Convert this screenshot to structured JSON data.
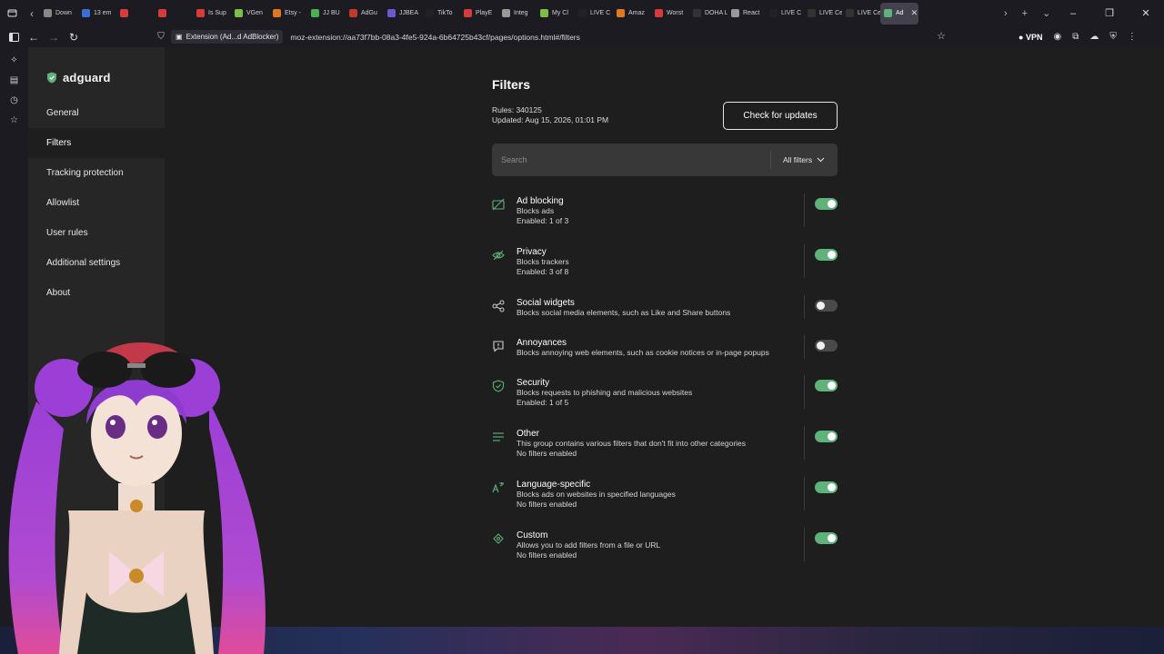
{
  "browser": {
    "tabs": [
      {
        "label": "Down",
        "color": "#888888"
      },
      {
        "label": "13 em",
        "color": "#3b6fd6"
      },
      {
        "label": "",
        "color": "#d93a3a"
      },
      {
        "label": "",
        "color": "#d93a3a"
      },
      {
        "label": "Is Sup",
        "color": "#d93a3a"
      },
      {
        "label": "VGen",
        "color": "#7bc043"
      },
      {
        "label": "Etsy -",
        "color": "#e0761f"
      },
      {
        "label": "JJ BU",
        "color": "#4caf50"
      },
      {
        "label": "AdGu",
        "color": "#c0392b"
      },
      {
        "label": "JJBEA",
        "color": "#6a5acd"
      },
      {
        "label": "TikTo",
        "color": "#222222"
      },
      {
        "label": "PlayE",
        "color": "#d93a3a"
      },
      {
        "label": "Integ",
        "color": "#999999"
      },
      {
        "label": "My Cl",
        "color": "#7bc043"
      },
      {
        "label": "LIVE C",
        "color": "#222222"
      },
      {
        "label": "Amaz",
        "color": "#e07b1f"
      },
      {
        "label": "Worst",
        "color": "#d93a3a"
      },
      {
        "label": "DOHA Liv",
        "color": "#333333"
      },
      {
        "label": "React",
        "color": "#999999"
      },
      {
        "label": "LIVE C",
        "color": "#222222"
      },
      {
        "label": "LIVE Cent",
        "color": "#333333"
      },
      {
        "label": "LIVE Cent",
        "color": "#333333"
      },
      {
        "label": "Ad",
        "color": "#5fb27a"
      }
    ],
    "extension_chip": "Extension (Ad...d AdBlocker)",
    "url": "moz-extension://aa73f7bb-08a3-4fe5-924a-6b64725b43cf/pages/options.html#/filters",
    "vpn_label": "VPN"
  },
  "sidebar": {
    "logo": "adguard",
    "items": [
      {
        "label": "General"
      },
      {
        "label": "Filters"
      },
      {
        "label": "Tracking protection"
      },
      {
        "label": "Allowlist"
      },
      {
        "label": "User rules"
      },
      {
        "label": "Additional settings"
      },
      {
        "label": "About"
      }
    ]
  },
  "main": {
    "title": "Filters",
    "rules": "Rules: 340125",
    "updated": "Updated: Aug 15, 2026, 01:01 PM",
    "check_updates": "Check for updates",
    "search_placeholder": "Search",
    "filter_dropdown": "All filters",
    "groups": [
      {
        "icon": "ad-blocking-icon",
        "title": "Ad blocking",
        "desc": "Blocks ads",
        "enabled": "Enabled: 1 of 3",
        "on": true
      },
      {
        "icon": "privacy-icon",
        "title": "Privacy",
        "desc": "Blocks trackers",
        "enabled": "Enabled: 3 of 8",
        "on": true
      },
      {
        "icon": "share-icon",
        "title": "Social widgets",
        "desc": "Blocks social media elements, such as Like and Share buttons",
        "enabled": "",
        "on": false
      },
      {
        "icon": "annoyance-icon",
        "title": "Annoyances",
        "desc": "Blocks annoying web elements, such as cookie notices or in-page popups",
        "enabled": "",
        "on": false
      },
      {
        "icon": "security-shield-icon",
        "title": "Security",
        "desc": "Blocks requests to phishing and malicious websites",
        "enabled": "Enabled: 1 of 5",
        "on": true
      },
      {
        "icon": "other-lines-icon",
        "title": "Other",
        "desc": "This group contains various filters that don't fit into other categories",
        "enabled": "No filters enabled",
        "on": true
      },
      {
        "icon": "language-icon",
        "title": "Language-specific",
        "desc": "Blocks ads on websites in specified languages",
        "enabled": "No filters enabled",
        "on": true
      },
      {
        "icon": "custom-icon",
        "title": "Custom",
        "desc": "Allows you to add filters from a file or URL",
        "enabled": "No filters enabled",
        "on": true
      }
    ]
  },
  "colors": {
    "accent": "#5fb27a",
    "background": "#1e1e1e",
    "sidebar": "#262626"
  }
}
